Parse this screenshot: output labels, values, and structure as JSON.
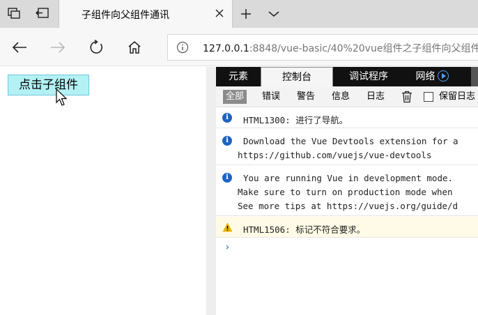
{
  "browser": {
    "tab": {
      "title": "子组件向父组件通讯"
    },
    "address": {
      "host": "127.0.0.1",
      "rest": ":8848/vue-basic/40%20vue组件之子组件向父组件"
    }
  },
  "page": {
    "button_label": "点击子组件"
  },
  "devtools": {
    "tabs": [
      "元素",
      "控制台",
      "调试程序",
      "网络"
    ],
    "filters": [
      "全部",
      "错误",
      "警告",
      "信息",
      "日志",
      "保留日志"
    ],
    "messages": [
      {
        "type": "info",
        "lines": [
          "HTML1300: 进行了导航。"
        ]
      },
      {
        "type": "info",
        "lines": [
          "Download the Vue Devtools extension for a",
          "https://github.com/vuejs/vue-devtools"
        ]
      },
      {
        "type": "info",
        "lines": [
          "You are running Vue in development mode.",
          "Make sure to turn on production mode when",
          "See more tips at https://vuejs.org/guide/d"
        ]
      },
      {
        "type": "warn",
        "lines": [
          "HTML1506: 标记不符合要求。"
        ]
      }
    ],
    "prompt": "›"
  }
}
